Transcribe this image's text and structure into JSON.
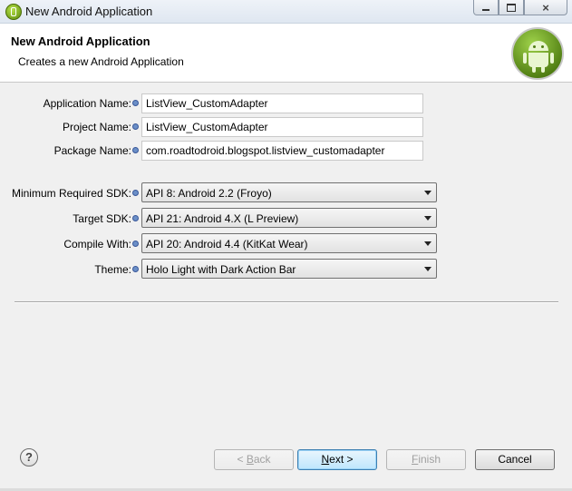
{
  "window": {
    "title": "New Android Application",
    "controls": {
      "minimize": "minimize-icon",
      "maximize": "maximize-icon",
      "close": "×"
    }
  },
  "header": {
    "title": "New Android Application",
    "description": "Creates a new Android Application",
    "logo": "android-robot-icon"
  },
  "form": {
    "application_name": {
      "label": "Application Name:",
      "value": "ListView_CustomAdapter"
    },
    "project_name": {
      "label": "Project Name:",
      "value": "ListView_CustomAdapter"
    },
    "package_name": {
      "label": "Package Name:",
      "value": "com.roadtodroid.blogspot.listview_customadapter"
    },
    "min_sdk": {
      "label": "Minimum Required SDK:",
      "value": "API 8: Android 2.2 (Froyo)"
    },
    "target_sdk": {
      "label": "Target SDK:",
      "value": "API 21: Android 4.X (L Preview)"
    },
    "compile_with": {
      "label": "Compile With:",
      "value": "API 20: Android 4.4 (KitKat Wear)"
    },
    "theme": {
      "label": "Theme:",
      "value": "Holo Light with Dark Action Bar"
    }
  },
  "buttons": {
    "help": "?",
    "back": {
      "prefix": "< ",
      "mnemonic": "B",
      "rest": "ack",
      "enabled": false
    },
    "next": {
      "mnemonic": "N",
      "rest": "ext >",
      "enabled": true
    },
    "finish": {
      "mnemonic": "F",
      "rest": "inish",
      "enabled": false
    },
    "cancel": {
      "label": "Cancel",
      "enabled": true
    }
  },
  "colors": {
    "info_icon": "#6b8fc7",
    "android_green": "#9fd24a",
    "default_button": "#bee6fd"
  }
}
